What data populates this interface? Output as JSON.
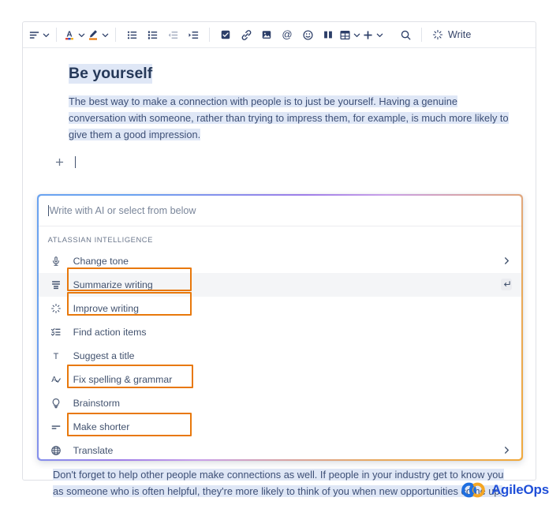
{
  "toolbar": {
    "groups": [
      {
        "name": "text-style",
        "items": [
          {
            "icon": "text-style-icon",
            "label": "Text styles",
            "caret": true
          }
        ]
      },
      {
        "name": "color",
        "items": [
          {
            "icon": "text-color-icon",
            "label": "Text color",
            "caret": true
          },
          {
            "icon": "highlight-color-icon",
            "label": "Highlight color",
            "caret": true
          }
        ]
      },
      {
        "name": "lists",
        "items": [
          {
            "icon": "bullet-list-icon",
            "label": "Bulleted list",
            "caret": false
          },
          {
            "icon": "numbered-list-icon",
            "label": "Numbered list",
            "caret": false
          },
          {
            "icon": "outdent-icon",
            "label": "Outdent",
            "caret": false
          },
          {
            "icon": "indent-icon",
            "label": "Indent",
            "caret": false
          }
        ]
      },
      {
        "name": "insert",
        "items": [
          {
            "icon": "task-checkbox-icon",
            "label": "Action item",
            "caret": false
          },
          {
            "icon": "link-icon",
            "label": "Link",
            "caret": false
          },
          {
            "icon": "image-icon",
            "label": "Image",
            "caret": false
          },
          {
            "icon": "mention-icon",
            "label": "Mention",
            "caret": false
          },
          {
            "icon": "emoji-icon",
            "label": "Emoji",
            "caret": false
          },
          {
            "icon": "layout-icon",
            "label": "Layouts",
            "caret": false
          },
          {
            "icon": "table-icon",
            "label": "Table",
            "caret": true
          },
          {
            "icon": "plus-insert-icon",
            "label": "Insert more",
            "caret": true
          }
        ]
      },
      {
        "name": "find",
        "items": [
          {
            "icon": "search-icon",
            "label": "Find and replace",
            "caret": false
          }
        ]
      }
    ],
    "write_button": {
      "icon": "ai-sparkle-icon",
      "label": "Write"
    }
  },
  "document": {
    "title": "Be yourself",
    "paragraph_top": "The best way to make a connection with people is to just be yourself. Having a genuine conversation with someone, rather than trying to impress them, for example, is much more likely to give them a good impression.",
    "paragraph_bottom": "Don't forget to help other people make connections as well. If people in your industry get to know you as someone who is often helpful, they're more likely to think of you when new opportunities come up.",
    "insert_handle_icon": "plus-icon"
  },
  "ai_panel": {
    "input_placeholder": "Write with AI or select from below",
    "section_label": "ATLASSIAN INTELLIGENCE",
    "items": [
      {
        "icon": "change-tone-icon",
        "label": "Change tone",
        "trailing": "chevron-right-icon",
        "active": false,
        "highlighted": false
      },
      {
        "icon": "summarize-icon",
        "label": "Summarize writing",
        "trailing": "enter-key-icon",
        "active": true,
        "highlighted": true
      },
      {
        "icon": "improve-writing-icon",
        "label": "Improve writing",
        "trailing": "",
        "active": false,
        "highlighted": true
      },
      {
        "icon": "action-items-icon",
        "label": "Find action items",
        "trailing": "",
        "active": false,
        "highlighted": false
      },
      {
        "icon": "suggest-title-icon",
        "label": "Suggest a title",
        "trailing": "",
        "active": false,
        "highlighted": false
      },
      {
        "icon": "spell-check-icon",
        "label": "Fix spelling & grammar",
        "trailing": "",
        "active": false,
        "highlighted": true
      },
      {
        "icon": "brainstorm-bulb-icon",
        "label": "Brainstorm",
        "trailing": "",
        "active": false,
        "highlighted": false
      },
      {
        "icon": "make-shorter-icon",
        "label": "Make shorter",
        "trailing": "",
        "active": false,
        "highlighted": true
      },
      {
        "icon": "translate-globe-icon",
        "label": "Translate",
        "trailing": "chevron-right-icon",
        "active": false,
        "highlighted": false
      }
    ]
  },
  "branding": {
    "name": "AgileOps",
    "logo_icon": "agileops-rings-icon"
  },
  "colors": {
    "accent_blue": "#1f4fd8",
    "accent_orange": "#f5a623",
    "annotation_orange": "#e8780b",
    "selection_blue": "#dfe7f6",
    "text_navy": "#42526e"
  }
}
